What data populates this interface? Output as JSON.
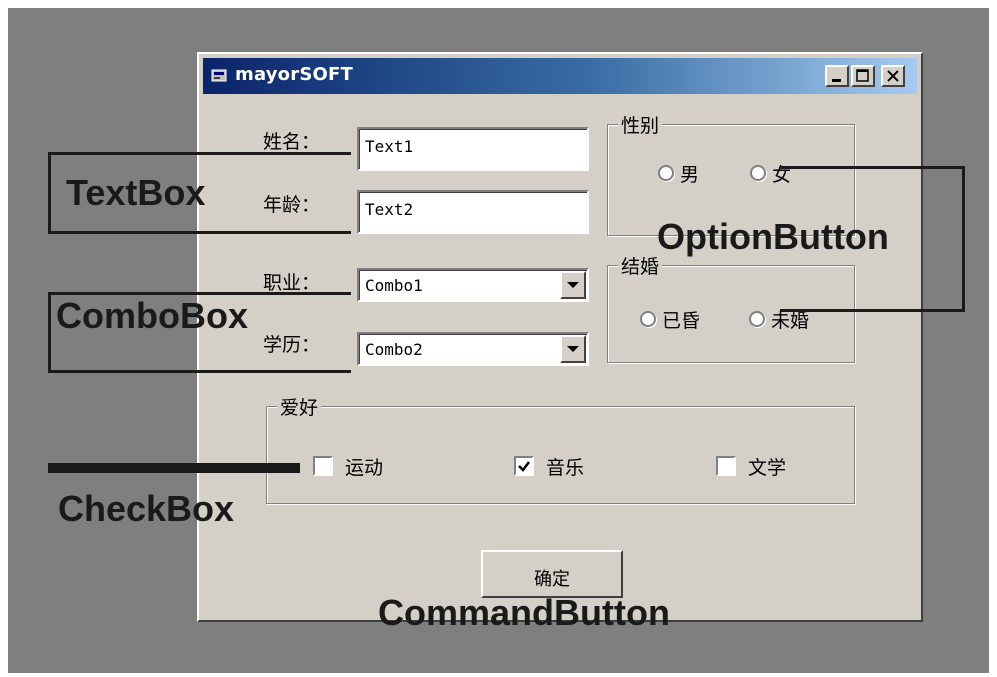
{
  "window": {
    "title": "mayorSOFT"
  },
  "form": {
    "name_label": "姓名：",
    "age_label": "年龄：",
    "job_label": "职业：",
    "edu_label": "学历：",
    "text1": "Text1",
    "text2": "Text2",
    "combo1": "Combo1",
    "combo2": "Combo2"
  },
  "gender": {
    "caption": "性别",
    "male": "男",
    "female": "女"
  },
  "marriage": {
    "caption": "结婚",
    "married": "已昏",
    "unmarried": "未婚"
  },
  "hobby": {
    "caption": "爱好",
    "items": [
      {
        "label": "运动",
        "checked": false
      },
      {
        "label": "音乐",
        "checked": true
      },
      {
        "label": "文学",
        "checked": false
      }
    ]
  },
  "ok_button": "确定",
  "annotations": {
    "textbox": "TextBox",
    "combobox": "ComboBox",
    "checkbox": "CheckBox",
    "optionbutton": "OptionButton",
    "commandbutton": "CommandButton"
  }
}
